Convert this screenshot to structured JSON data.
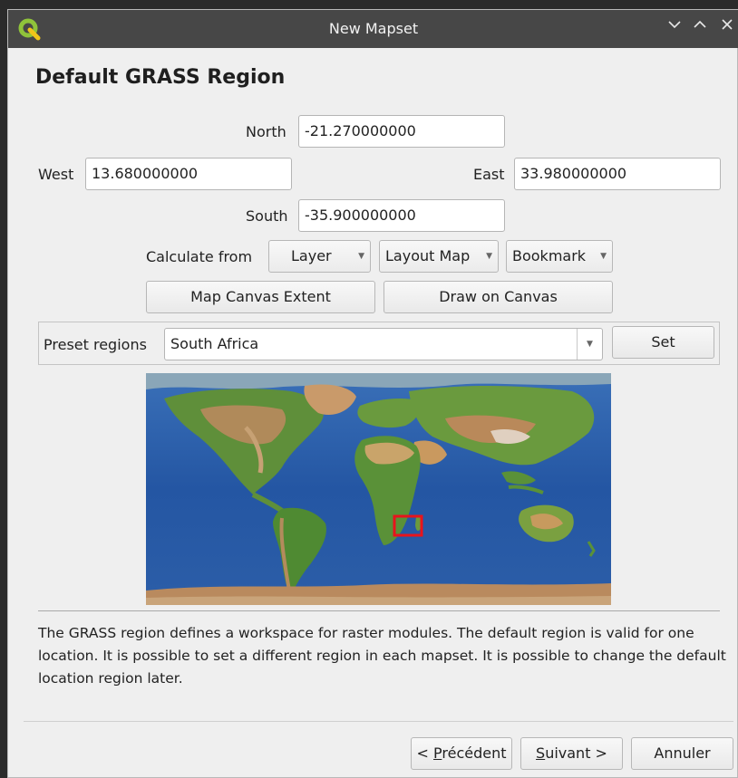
{
  "window": {
    "title": "New Mapset"
  },
  "page": {
    "heading": "Default GRASS Region"
  },
  "region": {
    "north_label": "North",
    "north_value": "-21.270000000",
    "west_label": "West",
    "west_value": "13.680000000",
    "east_label": "East",
    "east_value": "33.980000000",
    "south_label": "South",
    "south_value": "-35.900000000"
  },
  "calculate": {
    "label": "Calculate from",
    "layer": "Layer",
    "layout_map": "Layout Map",
    "bookmark": "Bookmark"
  },
  "buttons": {
    "map_canvas_extent": "Map Canvas Extent",
    "draw_on_canvas": "Draw on Canvas"
  },
  "preset": {
    "label": "Preset regions",
    "selected": "South Africa",
    "set_label": "Set"
  },
  "description": "The GRASS region defines a workspace for raster modules. The default region is valid for one location. It is possible to set a different region in each mapset. It is possible to change the default location region later.",
  "footer": {
    "back_prefix": "< ",
    "back_mnemonic": "P",
    "back_rest": "récédent",
    "next_mnemonic": "S",
    "next_rest": "uivant >",
    "cancel": "Annuler"
  },
  "colors": {
    "titlebar": "#474747",
    "dialog_bg": "#efefef",
    "region_box": "#e8141c",
    "qgis_green": "#8fc33a"
  },
  "icons": {
    "logo": "qgis-logo",
    "minimize": "chevron-down-icon",
    "maximize": "chevron-up-icon",
    "close": "close-icon"
  }
}
